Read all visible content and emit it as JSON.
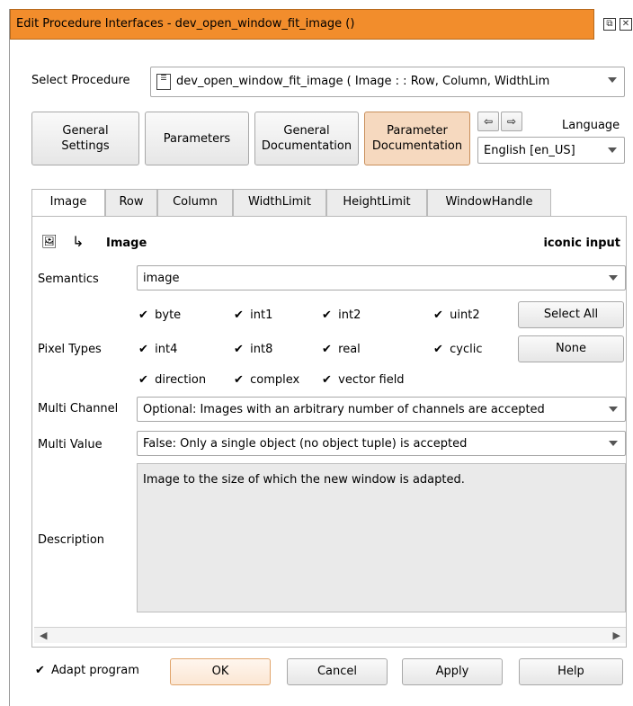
{
  "window": {
    "title": "Edit Procedure Interfaces - dev_open_window_fit_image ()",
    "title_icons": [
      "restore-icon",
      "close-icon"
    ]
  },
  "select_procedure": {
    "label": "Select Procedure",
    "value": "dev_open_window_fit_image ( Image : : Row, Column, WidthLimit, HeightLimit : WindowHandle )",
    "display_value": "dev_open_window_fit_image ( Image : : Row, Column, WidthLim"
  },
  "top_buttons": [
    {
      "label_line1": "General",
      "label_line2": "Settings"
    },
    {
      "label_line1": "Parameters",
      "label_line2": ""
    },
    {
      "label_line1": "General",
      "label_line2": "Documentation"
    },
    {
      "label_line1": "Parameter",
      "label_line2": "Documentation"
    }
  ],
  "language": {
    "label": "Language",
    "value": "English [en_US]"
  },
  "tabs": [
    "Image",
    "Row",
    "Column",
    "WidthLimit",
    "HeightLimit",
    "WindowHandle"
  ],
  "param_header": {
    "name": "Image",
    "kind": "iconic input"
  },
  "semantics": {
    "label": "Semantics",
    "value": "image"
  },
  "pixel_types": {
    "label": "Pixel Types",
    "items": [
      {
        "label": "byte",
        "checked": true
      },
      {
        "label": "int1",
        "checked": true
      },
      {
        "label": "int2",
        "checked": true
      },
      {
        "label": "uint2",
        "checked": true
      },
      {
        "label": "int4",
        "checked": true
      },
      {
        "label": "int8",
        "checked": true
      },
      {
        "label": "real",
        "checked": true
      },
      {
        "label": "cyclic",
        "checked": true
      },
      {
        "label": "direction",
        "checked": true
      },
      {
        "label": "complex",
        "checked": true
      },
      {
        "label": "vector field",
        "checked": true
      }
    ],
    "check_mark": "✔",
    "select_all_label": "Select All",
    "none_label": "None"
  },
  "multi_channel": {
    "label": "Multi Channel",
    "value": "Optional: Images with an arbitrary number of channels are accepted"
  },
  "multi_value": {
    "label": "Multi Value",
    "value": "False: Only a single object (no object tuple) is accepted"
  },
  "description": {
    "label": "Description",
    "text": "Image to the size of which the new window is adapted."
  },
  "footer": {
    "adapt_program_label": "Adapt program",
    "adapt_program_checked": true,
    "ok_label": "OK",
    "cancel_label": "Cancel",
    "apply_label": "Apply",
    "help_label": "Help"
  },
  "colors": {
    "titlebar": "#f28d2c",
    "active_button": "#f6d9bf",
    "description_bg": "#eaeaea"
  }
}
